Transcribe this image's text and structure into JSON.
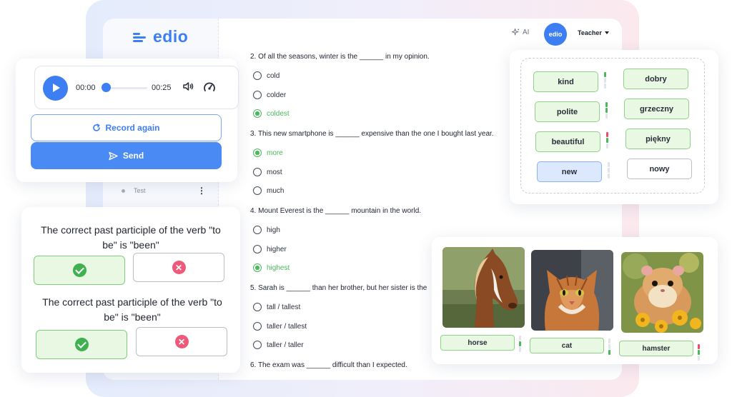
{
  "app": {
    "logo_text": "edio",
    "ai_label": "AI",
    "avatar_text": "edio",
    "role_label": "Teacher",
    "sidebar_test_label": "Test",
    "sidebar_more": "⋮",
    "brand_color": "#3d7ff2",
    "correct_color": "#4cb85c"
  },
  "quiz": {
    "q2": {
      "text": "2. Of all the seasons, winter is the ______ in my opinion.",
      "options": [
        "cold",
        "colder",
        "coldest"
      ],
      "selected": "coldest"
    },
    "q3": {
      "text": "3. This new smartphone is ______ expensive than the one I bought last year.",
      "options": [
        "more",
        "most",
        "much"
      ],
      "selected": "more"
    },
    "q4": {
      "text": "4. Mount Everest is the ______ mountain in the world.",
      "options": [
        "high",
        "higher",
        "highest"
      ],
      "selected": "highest"
    },
    "q5": {
      "text": "5. Sarah is ______ than her brother, but her sister is the",
      "options": [
        "tall / tallest",
        "taller / tallest",
        "taller / taller"
      ]
    },
    "q6": {
      "text": "6. The exam was ______ difficult than I expected."
    }
  },
  "audio": {
    "current_time": "00:00",
    "duration": "00:25",
    "progress": 0,
    "record_again_label": "Record again",
    "send_label": "Send"
  },
  "true_false": [
    {
      "statement": "The correct past participle of the verb \"to be\" is \"been\"",
      "selected": "true"
    },
    {
      "statement": "The correct past participle of the verb \"to be\" is \"been\"",
      "selected": "true"
    }
  ],
  "matching": {
    "left": [
      "kind",
      "polite",
      "beautiful",
      "new"
    ],
    "right": [
      "dobry",
      "grzeczny",
      "piękny",
      "nowy"
    ]
  },
  "images": {
    "labels": [
      "horse",
      "cat",
      "hamster"
    ],
    "icons": [
      "horse-photo",
      "cat-photo",
      "hamster-photo"
    ]
  }
}
